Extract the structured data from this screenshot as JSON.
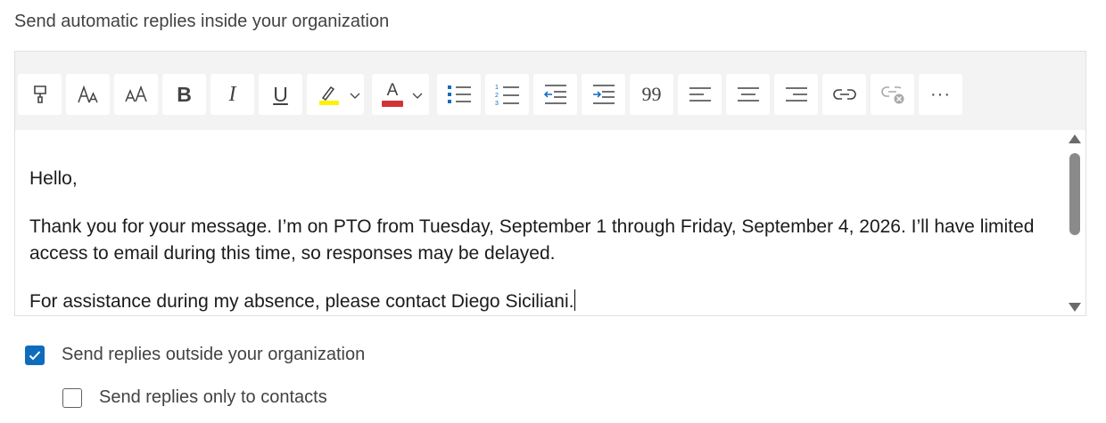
{
  "heading": "Send automatic replies inside your organization",
  "toolbar": {
    "items": [
      {
        "name": "format-painter"
      },
      {
        "name": "font"
      },
      {
        "name": "font-size"
      },
      {
        "name": "bold",
        "glyph": "B"
      },
      {
        "name": "italic",
        "glyph": "I"
      },
      {
        "name": "underline",
        "glyph": "U"
      },
      {
        "name": "highlight",
        "color": "#fff100"
      },
      {
        "name": "font-color",
        "color": "#d13438",
        "glyph": "A"
      },
      {
        "name": "bullets"
      },
      {
        "name": "numbering"
      },
      {
        "name": "decrease-indent"
      },
      {
        "name": "increase-indent"
      },
      {
        "name": "quote",
        "glyph": "99"
      },
      {
        "name": "align-left"
      },
      {
        "name": "align-center"
      },
      {
        "name": "align-right"
      },
      {
        "name": "insert-link"
      },
      {
        "name": "remove-link"
      },
      {
        "name": "more-options",
        "glyph": "···"
      }
    ]
  },
  "message": {
    "greeting": "Hello,",
    "paragraph1": "Thank you for your message. I’m on PTO from Tuesday, September 1 through Friday, September 4, 2026. I’ll have limited access to email during this time, so responses may be delayed.",
    "paragraph2": "For assistance during my absence, please contact Diego Siciliani."
  },
  "options": {
    "send_outside": {
      "label": "Send replies outside your organization",
      "checked": true
    },
    "only_contacts": {
      "label": "Send replies only to contacts",
      "checked": false
    }
  },
  "colors": {
    "accent": "#0f6cbd",
    "highlight": "#fff100",
    "font_color": "#d13438"
  }
}
